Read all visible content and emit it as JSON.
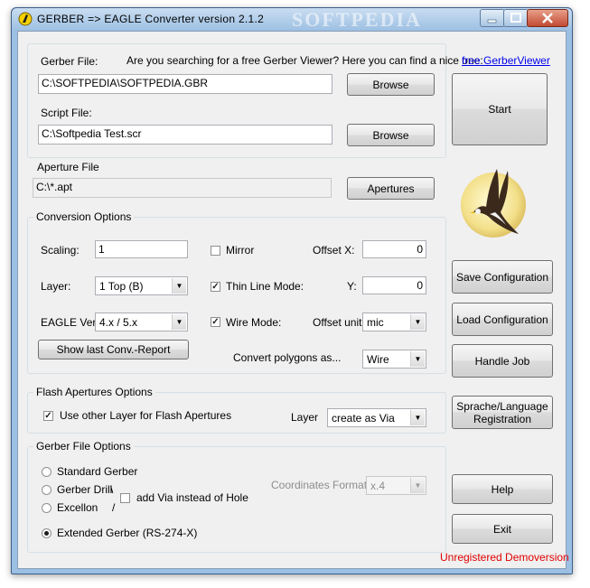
{
  "window": {
    "title": "GERBER => EAGLE Converter version  2.1.2",
    "watermark": "SOFTPEDIA"
  },
  "files": {
    "gerber_label": "Gerber File:",
    "gerber_value": "C:\\SOFTPEDIA\\SOFTPEDIA.GBR",
    "viewer_prompt": "Are you searching for a free Gerber Viewer? Here you can find a nice one:",
    "viewer_link": "free GerberViewer",
    "script_label": "Script File:",
    "script_value": "C:\\Softpedia Test.scr",
    "aperture_label": "Aperture File",
    "aperture_value": "C:\\*.apt",
    "browse_label": "Browse",
    "apertures_label": "Apertures",
    "start_label": "Start"
  },
  "conversion": {
    "title": "Conversion Options",
    "scaling_label": "Scaling:",
    "scaling_value": "1",
    "layer_label": "Layer:",
    "layer_value": "1  Top (B)",
    "eagle_label": "EAGLE Ver:",
    "eagle_value": "4.x / 5.x",
    "mirror_label": "Mirror",
    "mirror_checked": false,
    "thin_line_label": "Thin Line Mode:",
    "thin_line_checked": true,
    "wire_mode_label": "Wire Mode:",
    "wire_mode_checked": true,
    "offset_x_label": "Offset  X:",
    "offset_x_value": "0",
    "offset_y_label": "Y:",
    "offset_y_value": "0",
    "offset_unit_label": "Offset unit",
    "offset_unit_value": "mic",
    "report_button": "Show last Conv.-Report",
    "polygons_label": "Convert polygons as...",
    "polygons_value": "Wire"
  },
  "flash": {
    "title": "Flash Apertures Options",
    "use_other_layer_label": "Use other Layer for Flash Apertures",
    "use_other_layer_checked": true,
    "layer_label": "Layer",
    "layer_value": "create as Via"
  },
  "gerber_options": {
    "title": "Gerber File Options",
    "standard": "Standard Gerber",
    "drill": "Gerber Drill",
    "drill_sep": "\\",
    "excellon": "Excellon",
    "excellon_sep": "/",
    "extended": "Extended Gerber (RS-274-X)",
    "selected": "extended",
    "add_via_label": "add Via instead of Hole",
    "add_via_checked": false,
    "coord_label": "Coordinates Format",
    "coord_value": "x.4"
  },
  "side_buttons": {
    "save_config": "Save Configuration",
    "load_config": "Load Configuration",
    "handle_job": "Handle Job",
    "language_line1": "Sprache/Language",
    "language_line2": "Registration",
    "help": "Help",
    "exit": "Exit"
  },
  "status": {
    "text": "Unregistered Demoversion",
    "color": "#e00000"
  },
  "icons": {
    "app": "app-logo-icon",
    "logo": "eagle-logo-icon"
  }
}
